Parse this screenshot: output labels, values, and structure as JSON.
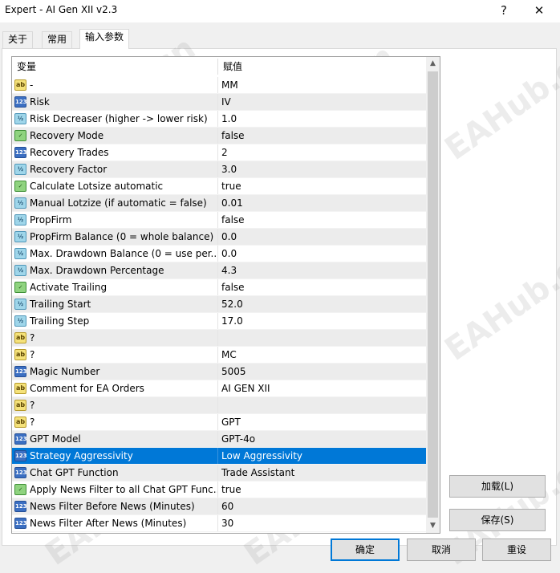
{
  "window": {
    "title": "Expert - AI Gen XII v2.3",
    "help_glyph": "?",
    "close_glyph": "✕"
  },
  "tabs": [
    "关于",
    "常用",
    "输入参数"
  ],
  "grid": {
    "header_variable": "变量",
    "header_value": "赋值",
    "rows": [
      {
        "type": "ab",
        "variable": "-",
        "value": " MM"
      },
      {
        "type": "123",
        "variable": "Risk",
        "value": "IV"
      },
      {
        "type": "v/2",
        "variable": "Risk Decreaser (higher -> lower risk)",
        "value": "1.0"
      },
      {
        "type": "bool",
        "variable": "Recovery Mode",
        "value": "false"
      },
      {
        "type": "123",
        "variable": "Recovery Trades",
        "value": "2"
      },
      {
        "type": "v/2",
        "variable": "Recovery Factor",
        "value": "3.0"
      },
      {
        "type": "bool",
        "variable": "Calculate Lotsize automatic",
        "value": "true"
      },
      {
        "type": "v/2",
        "variable": "Manual Lotzize (if automatic = false)",
        "value": "0.01"
      },
      {
        "type": "v/2",
        "variable": "PropFirm",
        "value": "false"
      },
      {
        "type": "v/2",
        "variable": "PropFirm Balance (0 = whole balance)",
        "value": "0.0"
      },
      {
        "type": "v/2",
        "variable": "Max. Drawdown Balance (0 = use per...",
        "value": "0.0"
      },
      {
        "type": "v/2",
        "variable": "Max. Drawdown Percentage",
        "value": "4.3"
      },
      {
        "type": "bool",
        "variable": "Activate Trailing",
        "value": "false"
      },
      {
        "type": "v/2",
        "variable": "Trailing Start",
        "value": "52.0"
      },
      {
        "type": "v/2",
        "variable": "Trailing Step",
        "value": "17.0"
      },
      {
        "type": "ab",
        "variable": "?",
        "value": ""
      },
      {
        "type": "ab",
        "variable": "?",
        "value": " MC"
      },
      {
        "type": "123",
        "variable": "Magic Number",
        "value": "5005"
      },
      {
        "type": "ab",
        "variable": "Comment for EA Orders",
        "value": "AI GEN XII"
      },
      {
        "type": "ab",
        "variable": "?",
        "value": ""
      },
      {
        "type": "ab",
        "variable": "?",
        "value": " GPT"
      },
      {
        "type": "123",
        "variable": "GPT Model",
        "value": "GPT-4o"
      },
      {
        "type": "123",
        "variable": "Strategy Aggressivity",
        "value": "Low Aggressivity",
        "selected": true
      },
      {
        "type": "123",
        "variable": "Chat GPT Function",
        "value": "Trade Assistant"
      },
      {
        "type": "bool",
        "variable": "Apply News Filter to all Chat GPT Func...",
        "value": "true"
      },
      {
        "type": "123",
        "variable": "News Filter Before News (Minutes)",
        "value": "60"
      },
      {
        "type": "123",
        "variable": "News Filter After News (Minutes)",
        "value": "30"
      }
    ]
  },
  "buttons": {
    "load": "加载(L)",
    "save": "保存(S)",
    "ok": "确定",
    "cancel": "取消",
    "reset": "重设"
  },
  "watermark": "EAHub.cn",
  "colors": {
    "selection": "#0078d7",
    "default_button_border": "#0078d7"
  }
}
